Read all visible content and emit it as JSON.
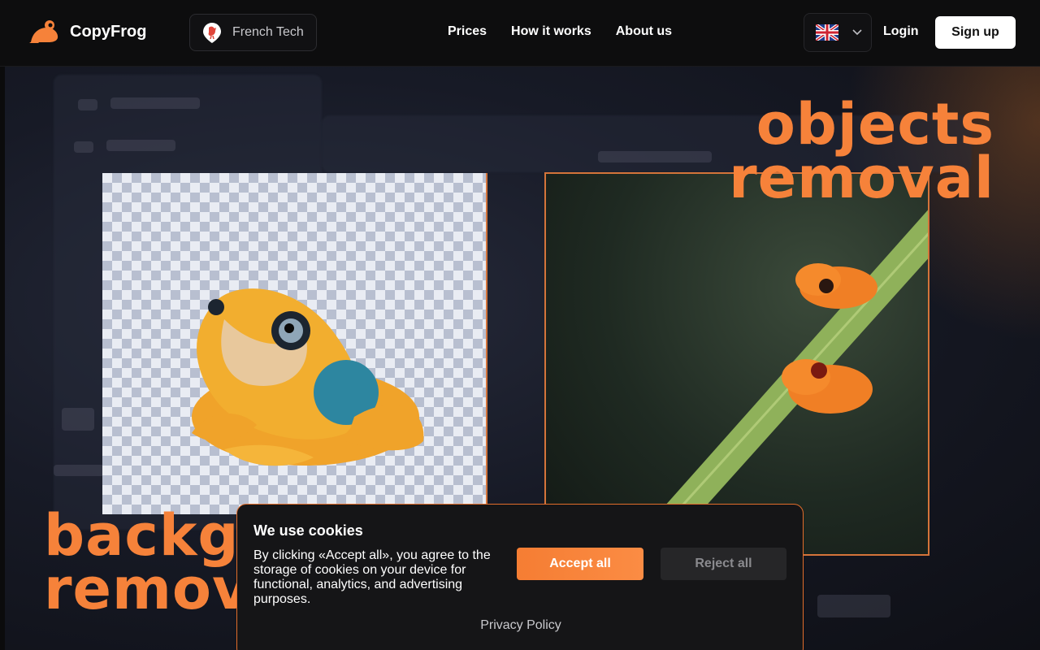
{
  "header": {
    "brand": "CopyFrog",
    "french_tech": "French Tech",
    "nav": [
      "Prices",
      "How it works",
      "About us"
    ],
    "login": "Login",
    "signup": "Sign up"
  },
  "hero": {
    "title_top": [
      "objects",
      "removal"
    ],
    "title_bottom": [
      "backg",
      "remov"
    ]
  },
  "cookie": {
    "title": "We use cookies",
    "text": "By clicking «Accept all», you agree to the storage of cookies on your device for functional, analytics, and advertising purposes.",
    "accept": "Accept all",
    "reject": "Reject all",
    "privacy": "Privacy Policy"
  },
  "colors": {
    "accent": "#f6823a",
    "header_bg": "#0d0d0e",
    "dialog_border": "#e26d2b"
  },
  "icons": {
    "logo": "frog-icon",
    "badge": "rooster-icon",
    "language": "uk-flag-icon",
    "dropdown": "chevron-down-icon"
  }
}
